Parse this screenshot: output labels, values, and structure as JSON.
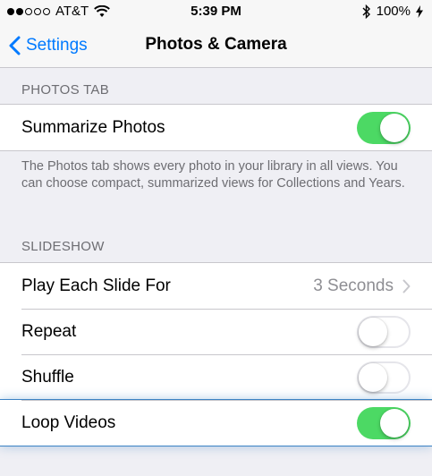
{
  "status_bar": {
    "carrier": "AT&T",
    "time": "5:39 PM",
    "battery": "100%"
  },
  "nav": {
    "back_label": "Settings",
    "title": "Photos & Camera"
  },
  "photos_tab": {
    "header": "PHOTOS TAB",
    "summarize_label": "Summarize Photos",
    "summarize_on": true,
    "note": "The Photos tab shows every photo in your library in all views. You can choose compact, summarized views for Collections and Years."
  },
  "slideshow": {
    "header": "SLIDESHOW",
    "play_label": "Play Each Slide For",
    "play_value": "3 Seconds",
    "repeat_label": "Repeat",
    "repeat_on": false,
    "shuffle_label": "Shuffle",
    "shuffle_on": false,
    "loop_label": "Loop Videos",
    "loop_on": true
  },
  "colors": {
    "accent": "#007aff",
    "toggle_on": "#4cd964",
    "background": "#efeff4"
  }
}
